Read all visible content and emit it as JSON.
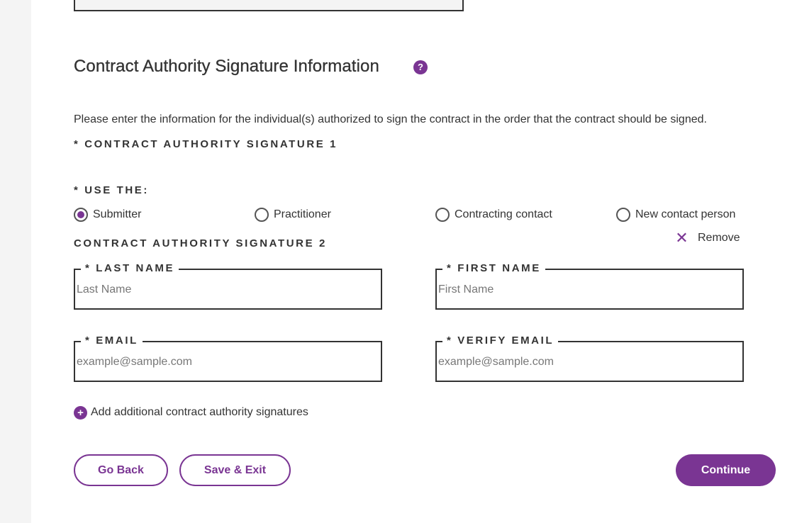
{
  "section": {
    "title": "Contract Authority Signature Information",
    "help_icon": "question-mark-icon",
    "instructions": "Please enter the information for the individual(s) authorized to sign the contract in the order that the contract should be signed."
  },
  "signature1": {
    "label": "* CONTRACT AUTHORITY SIGNATURE 1",
    "use_label": "* USE THE:",
    "options": [
      "Submitter",
      "Practitioner",
      "Contracting contact",
      "New contact person"
    ],
    "selected": "Submitter"
  },
  "signature2": {
    "label": "CONTRACT AUTHORITY SIGNATURE 2",
    "remove_label": "Remove",
    "fields": {
      "last_name": {
        "label": "* LAST NAME",
        "placeholder": "Last Name",
        "value": ""
      },
      "first_name": {
        "label": "* FIRST NAME",
        "placeholder": "First Name",
        "value": ""
      },
      "email": {
        "label": "* EMAIL",
        "placeholder": "example@sample.com",
        "value": ""
      },
      "verify_email": {
        "label": "* VERIFY EMAIL",
        "placeholder": "example@sample.com",
        "value": ""
      }
    }
  },
  "add_link": "Add additional contract authority signatures",
  "buttons": {
    "go_back": "Go Back",
    "save_exit": "Save & Exit",
    "continue": "Continue"
  },
  "colors": {
    "accent": "#7a3593",
    "text": "#333333",
    "rail": "#f4f4f4"
  }
}
